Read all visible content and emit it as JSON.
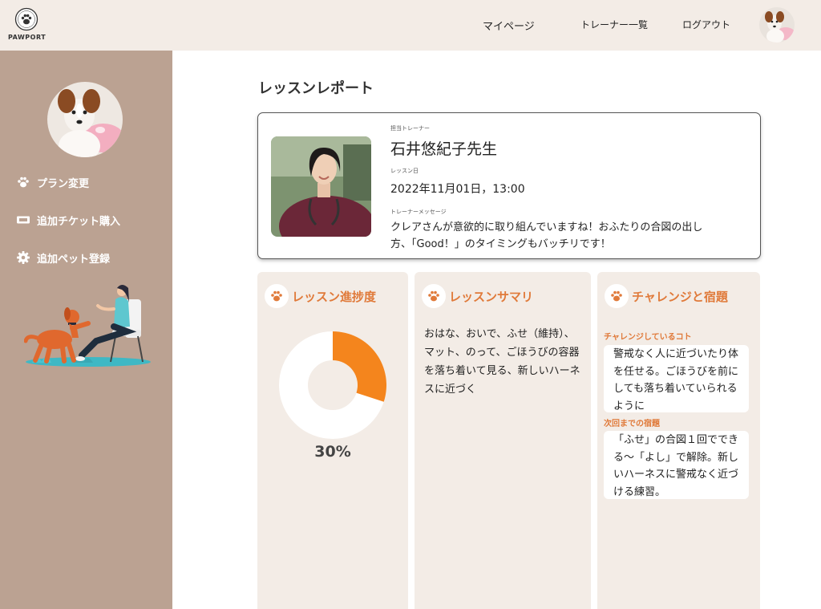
{
  "header": {
    "logo_text": "PAWPORT",
    "nav": {
      "mypage": "マイページ",
      "trainers": "トレーナー一覧",
      "logout": "ログアウト"
    }
  },
  "sidebar": {
    "items": [
      {
        "label": "プラン変更",
        "icon": "paw-icon"
      },
      {
        "label": "追加チケット購入",
        "icon": "ticket-icon"
      },
      {
        "label": "追加ペット登録",
        "icon": "gear-icon"
      }
    ]
  },
  "main": {
    "page_title": "レッスンレポート",
    "trainer_card": {
      "trainer_label": "担当トレーナー",
      "trainer_name": "石井悠紀子先生",
      "date_label": "レッスン日",
      "date_value": "2022年11月01日，13:00",
      "message_label": "トレーナーメッセージ",
      "message": "クレアさんが意欲的に取り組んでいますね！おふたりの合図の出し方、「Good！」のタイミングもバッチリです！"
    },
    "progress": {
      "title": "レッスン進捗度",
      "percent_text": "30%",
      "percent_value": 30
    },
    "summary": {
      "title": "レッスンサマリ",
      "text": "おはな、おいで、ふせ（維持）、マット、のって、ごほうびの容器を落ち着いて見る、新しいハーネスに近づく"
    },
    "challenge": {
      "title": "チャレンジと宿題",
      "challenge_label": "チャレンジしているコト",
      "challenge_text": "警戒なく人に近づいたり体を任せる。ごほうびを前にしても落ち着いていられるように",
      "homework_label": "次回までの宿題",
      "homework_text": "「ふせ」の合図１回でできる〜「よし」で解除。新しいハーネスに警戒なく近づける練習。"
    }
  },
  "colors": {
    "header_bg": "#f3ece6",
    "sidebar_bg": "#bba292",
    "panel_bg": "#f3ece6",
    "accent": "#e07a3a",
    "progress": "#f4851d"
  }
}
